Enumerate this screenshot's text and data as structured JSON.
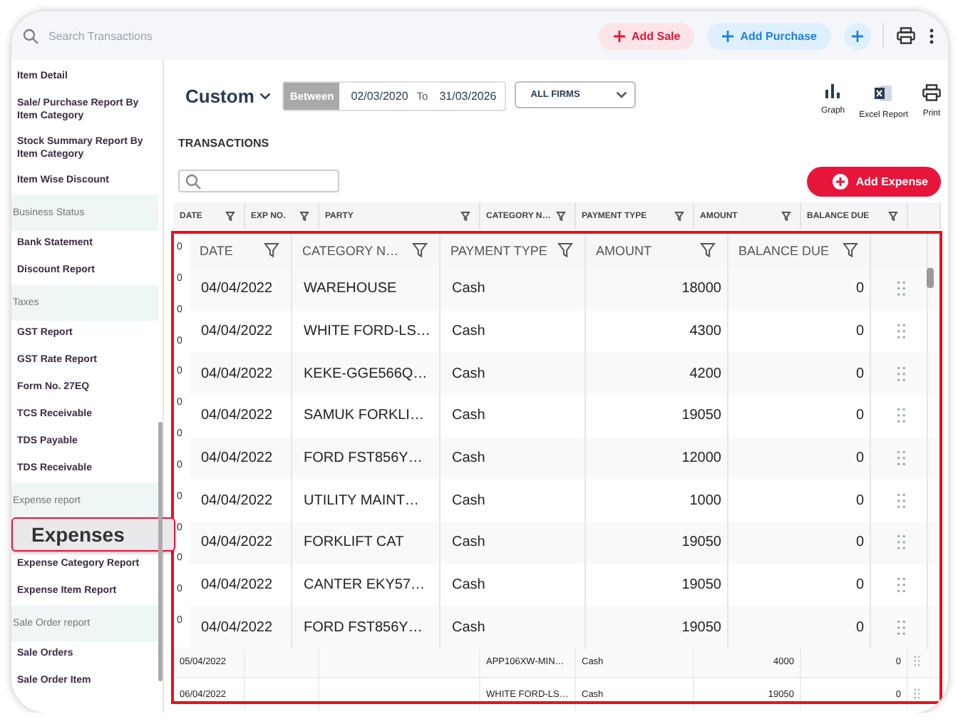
{
  "search": {
    "placeholder": "Search Transactions"
  },
  "top_actions": [
    {
      "label": "Add Sale",
      "kind": "sale"
    },
    {
      "label": "Add Purchase",
      "kind": "purchase"
    }
  ],
  "sidebar": {
    "items": [
      {
        "label": "Item Detail",
        "kind": "item"
      },
      {
        "label": "Sale/ Purchase Report By Item Category",
        "kind": "item"
      },
      {
        "label": "Stock Summary Report By Item Category",
        "kind": "item"
      },
      {
        "label": "Item Wise Discount",
        "kind": "item"
      },
      {
        "label": "Business Status",
        "kind": "section"
      },
      {
        "label": "Bank Statement",
        "kind": "item"
      },
      {
        "label": "Discount Report",
        "kind": "item"
      },
      {
        "label": "Taxes",
        "kind": "section"
      },
      {
        "label": "GST Report",
        "kind": "item"
      },
      {
        "label": "GST Rate Report",
        "kind": "item"
      },
      {
        "label": "Form No. 27EQ",
        "kind": "item"
      },
      {
        "label": "TCS Receivable",
        "kind": "item"
      },
      {
        "label": "TDS Payable",
        "kind": "item"
      },
      {
        "label": "TDS Receivable",
        "kind": "item"
      },
      {
        "label": "Expense report",
        "kind": "section"
      },
      {
        "label": "Expenses",
        "kind": "magnified"
      },
      {
        "label": "Expense Category Report",
        "kind": "item"
      },
      {
        "label": "Expense Item Report",
        "kind": "item"
      },
      {
        "label": "Sale Order report",
        "kind": "section"
      },
      {
        "label": "Sale Orders",
        "kind": "item"
      },
      {
        "label": "Sale Order Item",
        "kind": "item"
      }
    ]
  },
  "period": {
    "label": "Custom",
    "range_label": "Between",
    "from": "02/03/2020",
    "to_label": "To",
    "to": "31/03/2026"
  },
  "firm_select": {
    "value": "ALL FIRMS"
  },
  "report_tools": [
    {
      "label": "Graph",
      "kind": "graph"
    },
    {
      "label": "Excel Report",
      "kind": "excel"
    },
    {
      "label": "Print",
      "kind": "print"
    }
  ],
  "section_title": "TRANSACTIONS",
  "add_expense": "Add Expense",
  "table": {
    "columns": [
      "DATE",
      "EXP NO.",
      "PARTY",
      "CATEGORY N…",
      "PAYMENT TYPE",
      "AMOUNT",
      "BALANCE DUE"
    ],
    "rows": [
      {
        "date": "05/04/2022",
        "category": "APP106XW-MIN…",
        "payment_type": "Cash",
        "amount": "4000",
        "balance_due": "0"
      },
      {
        "date": "06/04/2022",
        "category": "WHITE FORD-LS…",
        "payment_type": "Cash",
        "amount": "19050",
        "balance_due": "0"
      }
    ]
  },
  "magnifier": {
    "edge_digits": [
      "0",
      "0",
      "0",
      "0",
      "0",
      "0",
      "0",
      "0",
      "0",
      "0",
      "0",
      "0",
      "0"
    ],
    "columns": [
      "DATE",
      "CATEGORY N…",
      "PAYMENT TYPE",
      "AMOUNT",
      "BALANCE DUE"
    ],
    "rows": [
      {
        "date": "04/04/2022",
        "category": "WAREHOUSE",
        "payment_type": "Cash",
        "amount": "18000",
        "balance_due": "0"
      },
      {
        "date": "04/04/2022",
        "category": "WHITE FORD-LS…",
        "payment_type": "Cash",
        "amount": "4300",
        "balance_due": "0"
      },
      {
        "date": "04/04/2022",
        "category": "KEKE-GGE566Q…",
        "payment_type": "Cash",
        "amount": "4200",
        "balance_due": "0"
      },
      {
        "date": "04/04/2022",
        "category": "SAMUK FORKLI…",
        "payment_type": "Cash",
        "amount": "19050",
        "balance_due": "0"
      },
      {
        "date": "04/04/2022",
        "category": "FORD FST856Y…",
        "payment_type": "Cash",
        "amount": "12000",
        "balance_due": "0"
      },
      {
        "date": "04/04/2022",
        "category": "UTILITY MAINT…",
        "payment_type": "Cash",
        "amount": "1000",
        "balance_due": "0"
      },
      {
        "date": "04/04/2022",
        "category": "FORKLIFT CAT",
        "payment_type": "Cash",
        "amount": "19050",
        "balance_due": "0"
      },
      {
        "date": "04/04/2022",
        "category": "CANTER EKY57…",
        "payment_type": "Cash",
        "amount": "19050",
        "balance_due": "0"
      },
      {
        "date": "04/04/2022",
        "category": "FORD FST856Y…",
        "payment_type": "Cash",
        "amount": "19050",
        "balance_due": "0"
      }
    ]
  }
}
